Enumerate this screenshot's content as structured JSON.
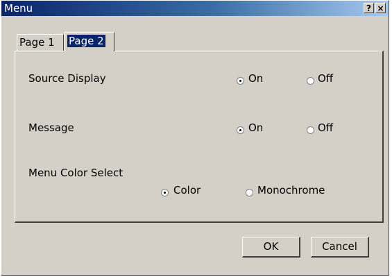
{
  "window": {
    "title": "Menu"
  },
  "titlebar_buttons": {
    "help": "?",
    "close": "×"
  },
  "tabs": [
    {
      "label": "Page 1",
      "selected": false
    },
    {
      "label": "Page 2",
      "selected": true
    }
  ],
  "settings": {
    "source_display": {
      "label": "Source Display",
      "on_label": "On",
      "off_label": "Off",
      "value": "On"
    },
    "message": {
      "label": "Message",
      "on_label": "On",
      "off_label": "Off",
      "value": "On"
    },
    "menu_color_select": {
      "label": "Menu Color Select",
      "color_label": "Color",
      "mono_label": "Monochrome",
      "value": "Color"
    }
  },
  "buttons": {
    "ok": "OK",
    "cancel": "Cancel"
  }
}
